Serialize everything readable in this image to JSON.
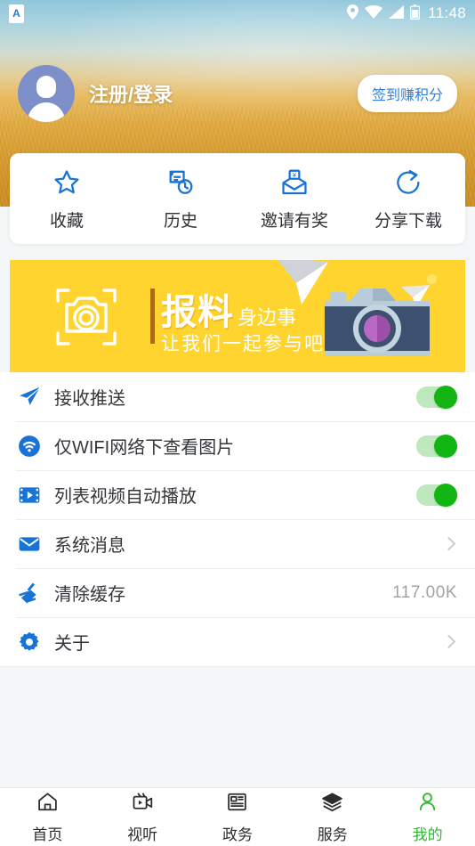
{
  "meta": {
    "screen_title": "我的",
    "theme": {
      "accent_blue": "#1773d6",
      "banner_yellow": "#ffd42e",
      "switch_on_green": "#12b512",
      "nav_active_green": "#2fba2f",
      "avatar_blue": "#7c8fc9",
      "text_primary": "#33363a",
      "text_muted": "#a0a3a6"
    }
  },
  "statusbar": {
    "app_badge": "A",
    "app_badge_icon": "app-notification-icon",
    "location_icon": "location-pin-icon",
    "wifi_icon": "wifi-icon",
    "signal_icon": "cellular-signal-icon",
    "battery_icon": "battery-icon",
    "time": "11:48"
  },
  "header": {
    "avatar_icon": "user-avatar-icon",
    "login_label": "注册/登录",
    "signin_button": "签到赚积分"
  },
  "quick_actions": [
    {
      "label": "收藏",
      "icon": "star-icon"
    },
    {
      "label": "历史",
      "icon": "history-icon"
    },
    {
      "label": "邀请有奖",
      "icon": "envelope-reward-icon"
    },
    {
      "label": "分享下载",
      "icon": "share-download-icon"
    }
  ],
  "banner": {
    "camera_outline_icon": "camera-frame-icon",
    "title_main": "报料",
    "title_sub": "身边事",
    "subtitle": "让我们一起参与吧",
    "illustration_icon": "camera-illustration-icon"
  },
  "settings": [
    {
      "label": "接收推送",
      "icon": "paper-plane-icon",
      "type": "switch",
      "value": "on"
    },
    {
      "label": "仅WIFI网络下查看图片",
      "icon": "wifi-icon",
      "type": "switch",
      "value": "on"
    },
    {
      "label": "列表视频自动播放",
      "icon": "video-play-icon",
      "type": "switch",
      "value": "on"
    },
    {
      "label": "系统消息",
      "icon": "envelope-icon",
      "type": "chevron",
      "value": ""
    },
    {
      "label": "清除缓存",
      "icon": "broom-icon",
      "type": "value",
      "value": "117.00K"
    },
    {
      "label": "关于",
      "icon": "gear-icon",
      "type": "chevron",
      "value": ""
    }
  ],
  "bottom_nav": [
    {
      "label": "首页",
      "icon": "home-icon",
      "active": false
    },
    {
      "label": "视听",
      "icon": "video-camera-icon",
      "active": false
    },
    {
      "label": "政务",
      "icon": "newspaper-icon",
      "active": false
    },
    {
      "label": "服务",
      "icon": "layers-icon",
      "active": false
    },
    {
      "label": "我的",
      "icon": "person-icon",
      "active": true
    }
  ]
}
